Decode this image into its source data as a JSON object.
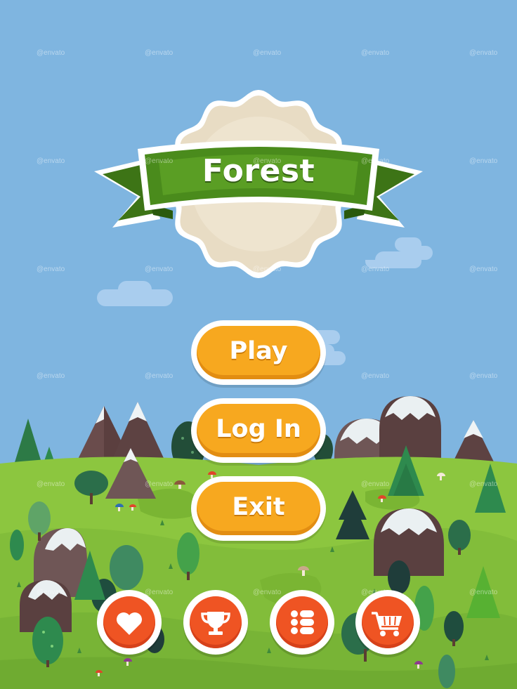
{
  "game": {
    "title": "Forest",
    "menu": {
      "play_label": "Play",
      "login_label": "Log In",
      "exit_label": "Exit"
    },
    "round_buttons": [
      {
        "icon": "heart-icon"
      },
      {
        "icon": "trophy-icon"
      },
      {
        "icon": "list-icon"
      },
      {
        "icon": "cart-icon"
      }
    ],
    "watermark": "envato"
  },
  "colors": {
    "sky": "#7fb5e0",
    "grass": "#8cc63f",
    "ribbon": "#4a8b1c",
    "badge": "#e8dcc4",
    "menu_button": "#f7a81f",
    "round_button": "#ef5423"
  }
}
